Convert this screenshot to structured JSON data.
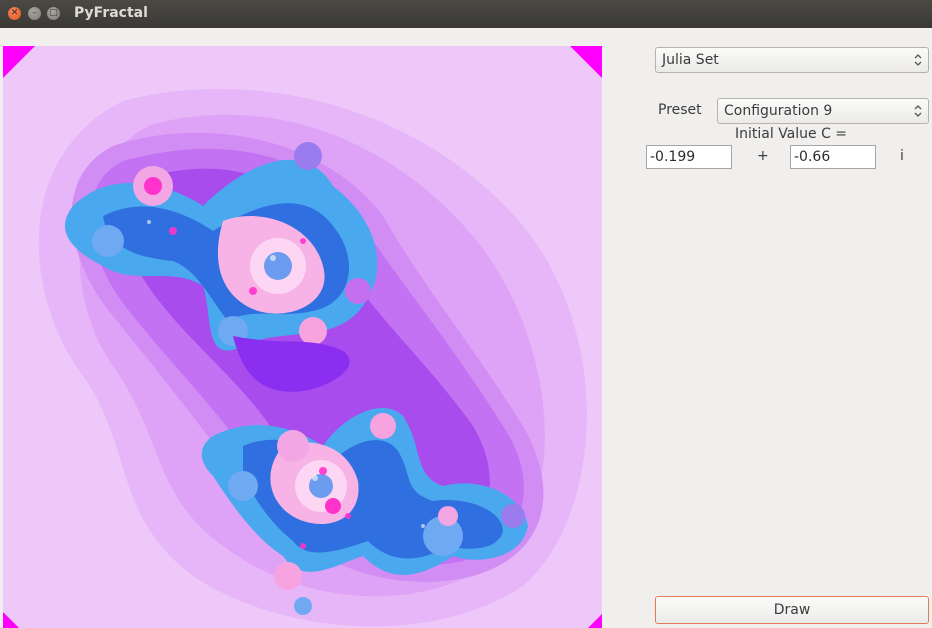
{
  "window": {
    "title": "PyFractal"
  },
  "controls": {
    "fractal_type": "Julia Set",
    "preset_label": "Preset",
    "preset_value": "Configuration 9",
    "initial_value_label": "Initial Value C =",
    "c_real": "-0.199",
    "plus": "+",
    "c_imag": "-0.66",
    "imag_unit": "i",
    "draw_label": "Draw"
  },
  "colors": {
    "canvas_background": "#edc8f9",
    "corner": "#ff00ff",
    "draw_button_border": "#e37a58"
  }
}
